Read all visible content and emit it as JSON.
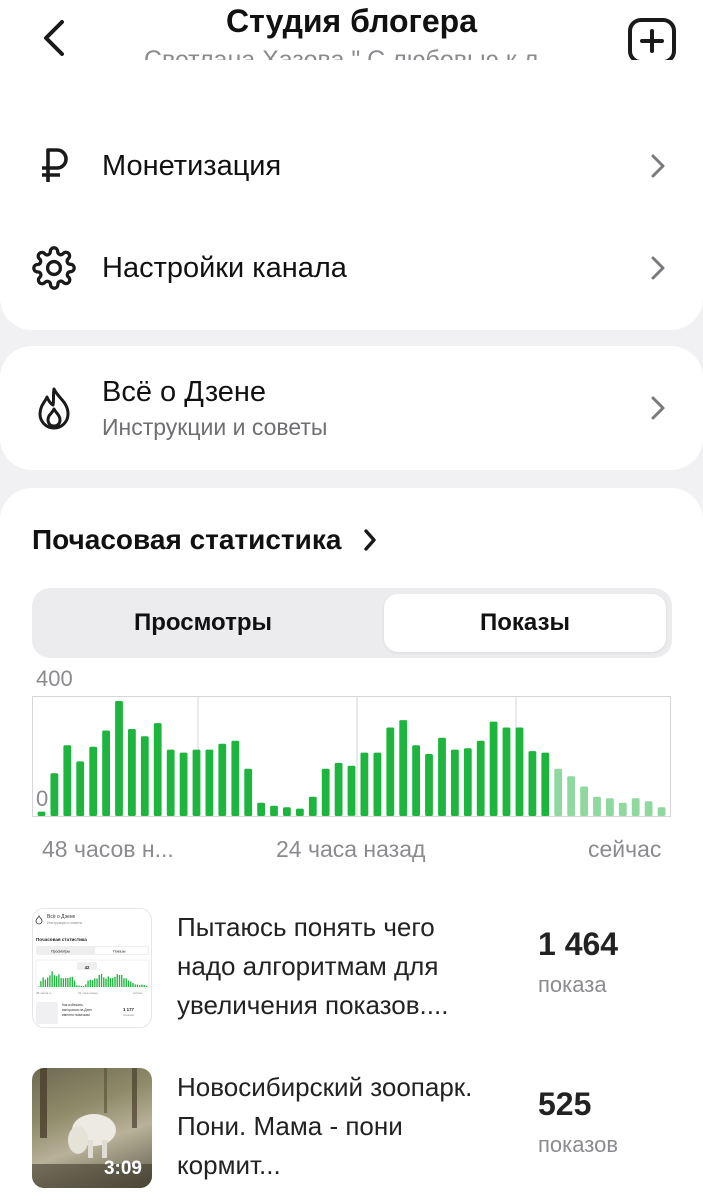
{
  "header": {
    "title": "Студия блогера",
    "subtitle": "Светлана Хазова \" С любовью к л..."
  },
  "menu": [
    {
      "label": "Монетизация",
      "icon": "ruble-icon"
    },
    {
      "label": "Настройки канала",
      "icon": "gear-icon"
    }
  ],
  "zen": {
    "title": "Всё о Дзене",
    "subtitle": "Инструкции и советы",
    "icon": "flame-icon"
  },
  "stats": {
    "title": "Почасовая статистика",
    "tabs": [
      {
        "label": "Просмотры",
        "selected": false
      },
      {
        "label": "Показы",
        "selected": true
      }
    ]
  },
  "chart_data": {
    "type": "bar",
    "ylim": [
      0,
      400
    ],
    "ytick_labels": [
      "400",
      "0"
    ],
    "xtick_labels": [
      "48 часов н...",
      "24 часа назад",
      "сейчас"
    ],
    "values": [
      15,
      145,
      240,
      185,
      235,
      290,
      390,
      295,
      270,
      315,
      225,
      215,
      225,
      225,
      245,
      255,
      160,
      45,
      35,
      30,
      25,
      65,
      160,
      180,
      170,
      215,
      215,
      300,
      325,
      240,
      210,
      265,
      225,
      230,
      255,
      320,
      300,
      300,
      220,
      215,
      160,
      135,
      100,
      65,
      60,
      45,
      60,
      50,
      30
    ],
    "bar_color": "#1db53d",
    "faded_color": "#8fd9a0",
    "faded_from_index": 40
  },
  "videos": [
    {
      "title": "Пытаюсь понять чего надо алгоритмам для увеличения показов....",
      "count": "1 464",
      "count_label": "показа",
      "thumb_text": {
        "zen": "Всё о Дзене",
        "zen_sub": "Инструкции и советы",
        "stats": "Почасовая статистика",
        "tab1": "Просмотры",
        "tab2": "Показы",
        "peak": "42",
        "l": "48 часов н...",
        "m": "24 часа назад",
        "r": "сейчас",
        "line1": "Как избежать",
        "line2": "выгорания на Дзен",
        "line3": "именно новичкам",
        "count": "1 177",
        "count_label": "показов"
      }
    },
    {
      "title": "Новосибирский зоопарк. Пони. Мама - пони кормит...",
      "count": "525",
      "count_label": "показов",
      "duration": "3:09"
    }
  ]
}
